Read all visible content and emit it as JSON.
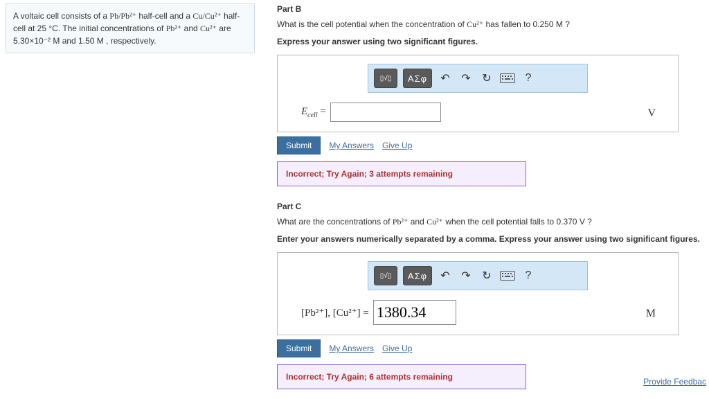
{
  "left": {
    "text_parts": [
      "A voltaic cell consists of a ",
      "Pb/Pb²⁺",
      " half-cell and a ",
      "Cu/Cu²⁺",
      " half-cell at 25 °C. The initial concentrations of ",
      "Pb²⁺",
      " and ",
      "Cu²⁺",
      " are 5.30×10⁻² M and 1.50 M , respectively."
    ]
  },
  "partB": {
    "header": "Part B",
    "question_pre": "What is the cell potential when the concentration of ",
    "question_species": "Cu²⁺",
    "question_post": " has fallen to 0.250 M ?",
    "instruction": "Express your answer using two significant figures.",
    "var_label_html": "E_cell =",
    "unit": "V",
    "input_value": "",
    "submit": "Submit",
    "my_answers": "My Answers",
    "give_up": "Give Up",
    "feedback": "Incorrect; Try Again; 3 attempts remaining"
  },
  "partC": {
    "header": "Part C",
    "question_pre": "What are the concentrations of ",
    "q_s1": "Pb²⁺",
    "q_mid": " and ",
    "q_s2": "Cu²⁺",
    "question_post": " when the cell potential falls to 0.370 V ?",
    "instruction": "Enter your answers numerically separated by a comma. Express your answer using two significant figures.",
    "var_label_html": "[Pb²⁺], [Cu²⁺] =",
    "unit": "M",
    "input_value": "1380.34",
    "submit": "Submit",
    "my_answers": "My Answers",
    "give_up": "Give Up",
    "feedback": "Incorrect; Try Again; 6 attempts remaining"
  },
  "toolbar": {
    "templates_icon": "▯√▯",
    "greek": "ΑΣφ",
    "undo": "↶",
    "redo": "↷",
    "reset": "↻",
    "keyboard": "kbd",
    "help": "?"
  },
  "footer": {
    "provide_feedback": "Provide Feedbac"
  }
}
